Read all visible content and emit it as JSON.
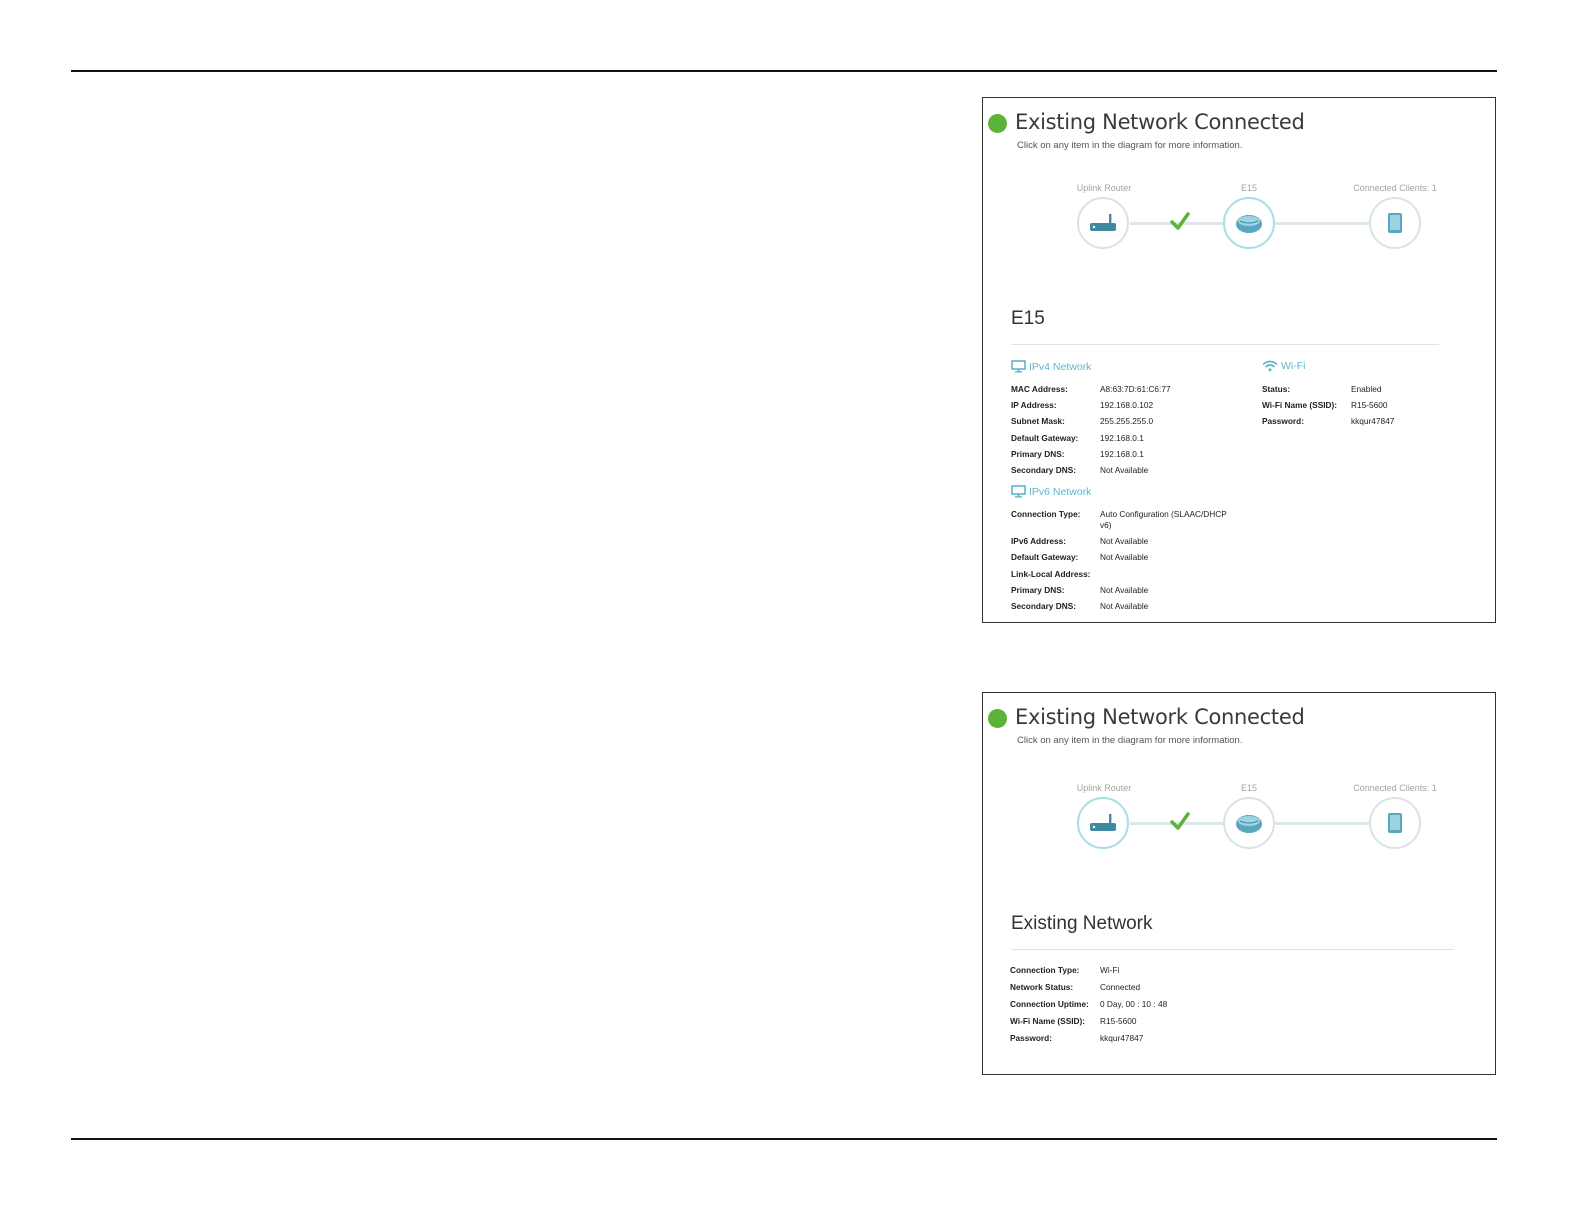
{
  "panel_top": {
    "title": "Existing Network Connected",
    "subtitle": "Click on any item in the diagram for more information.",
    "nodes": {
      "uplink": "Uplink Router",
      "device": "E15",
      "clients": "Connected Clients: 1"
    },
    "section_title": "E15",
    "ipv4": {
      "heading": "IPv4 Network",
      "rows": [
        {
          "k": "MAC Address:",
          "v": "A8:63:7D:61:C6:77"
        },
        {
          "k": "IP Address:",
          "v": "192.168.0.102"
        },
        {
          "k": "Subnet Mask:",
          "v": "255.255.255.0"
        },
        {
          "k": "Default Gateway:",
          "v": "192.168.0.1"
        },
        {
          "k": "Primary DNS:",
          "v": "192.168.0.1"
        },
        {
          "k": "Secondary DNS:",
          "v": "Not Available"
        }
      ]
    },
    "wifi": {
      "heading": "Wi-Fi",
      "rows": [
        {
          "k": "Status:",
          "v": "Enabled"
        },
        {
          "k": "Wi-Fi Name (SSID):",
          "v": "R15-5600"
        },
        {
          "k": "Password:",
          "v": "kkqur47847"
        }
      ]
    },
    "ipv6": {
      "heading": "IPv6 Network",
      "rows": [
        {
          "k": "Connection Type:",
          "v": "Auto Configuration (SLAAC/DHCP v6)"
        },
        {
          "k": "IPv6 Address:",
          "v": "Not Available"
        },
        {
          "k": "Default Gateway:",
          "v": "Not Available"
        },
        {
          "k": "Link-Local Address:",
          "v": ""
        },
        {
          "k": "Primary DNS:",
          "v": "Not Available"
        },
        {
          "k": "Secondary DNS:",
          "v": "Not Available"
        }
      ]
    }
  },
  "panel_bottom": {
    "title": "Existing Network Connected",
    "subtitle": "Click on any item in the diagram for more information.",
    "nodes": {
      "uplink": "Uplink Router",
      "device": "E15",
      "clients": "Connected Clients: 1"
    },
    "section_title": "Existing Network",
    "rows": [
      {
        "k": "Connection Type:",
        "v": "Wi-Fi"
      },
      {
        "k": "Network Status:",
        "v": "Connected"
      },
      {
        "k": "Connection Uptime:",
        "v": "0 Day,  00 : 10 : 48"
      },
      {
        "k": "Wi-Fi Name (SSID):",
        "v": "R15-5600"
      },
      {
        "k": "Password:",
        "v": "kkqur47847"
      }
    ]
  },
  "colors": {
    "status_green": "#5cb33a",
    "accent_teal": "#5fb6cc",
    "device_teal": "#3f8aa0"
  },
  "icons": [
    "status-dot",
    "router-icon",
    "checkmark-icon",
    "extender-icon",
    "tablet-icon",
    "monitor-icon",
    "wifi-icon"
  ]
}
